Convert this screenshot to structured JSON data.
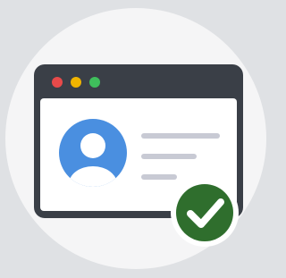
{
  "colors": {
    "background": "#dfe1e4",
    "circle": "#f5f5f6",
    "window_frame": "#3a3f47",
    "window_body": "#ffffff",
    "dot_red": "#e84a4a",
    "dot_yellow": "#f0b400",
    "dot_green": "#3fbf5c",
    "avatar": "#4a8fe0",
    "avatar_figure": "#ffffff",
    "text_lines": "#c8cad4",
    "badge": "#2f6e2d",
    "badge_ring": "#ffffff",
    "checkmark": "#ffffff"
  },
  "icons": {
    "window": "browser-window-icon",
    "profile": "user-avatar-icon",
    "verified": "checkmark-badge-icon"
  }
}
